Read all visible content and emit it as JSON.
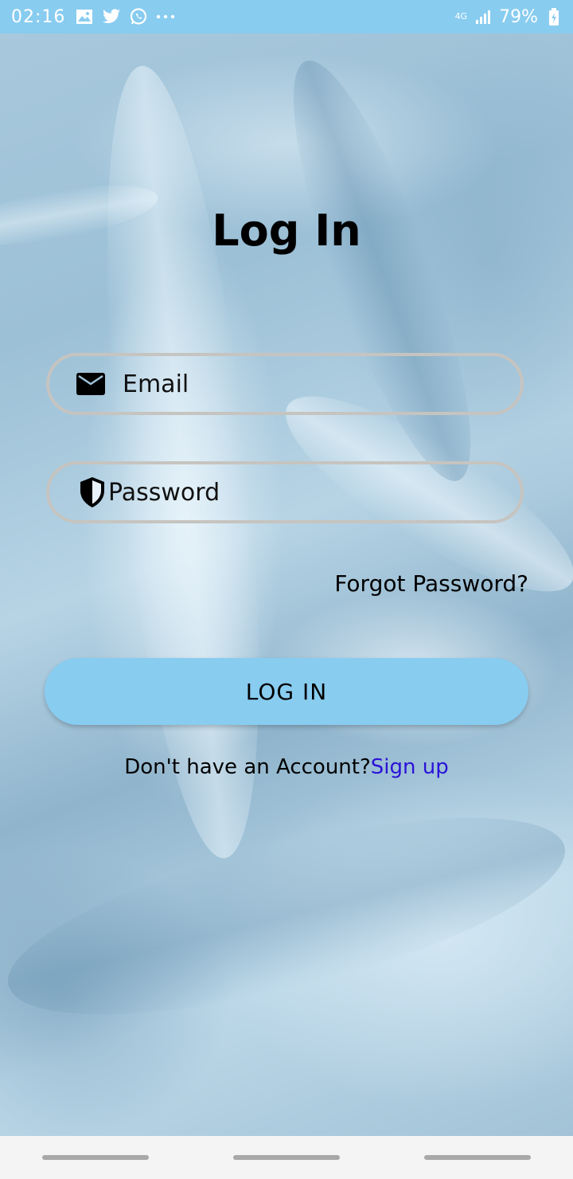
{
  "status_bar": {
    "time": "02:16",
    "network": "4G",
    "battery": "79%",
    "icons": [
      "image-icon",
      "twitter-icon",
      "whatsapp-icon",
      "more-dots-icon",
      "signal-icon",
      "battery-charging-icon"
    ]
  },
  "login": {
    "title": "Log In",
    "email_placeholder": "Email",
    "password_placeholder": "Password",
    "forgot_label": "Forgot Password?",
    "button_label": "LOG IN",
    "no_account_text": "Don't have an Account?",
    "signup_label": "Sign up"
  },
  "colors": {
    "accent": "#88ccf0",
    "link": "#2b13d8",
    "field_border": "#c6c4c0"
  }
}
